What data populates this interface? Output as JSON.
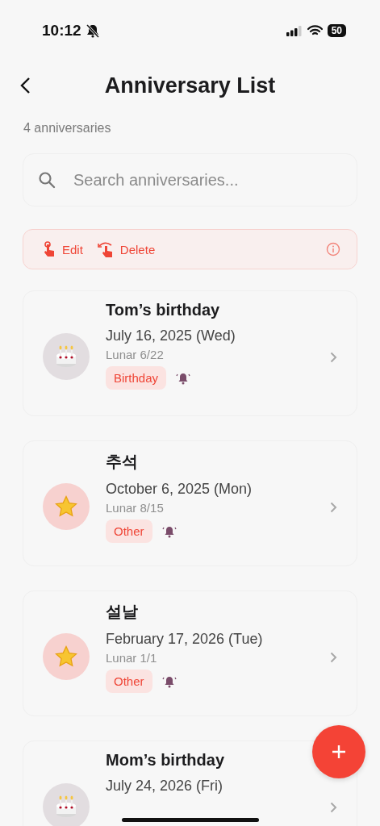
{
  "status_bar": {
    "time": "10:12",
    "silent": true,
    "battery": "50"
  },
  "header": {
    "title": "Anniversary List"
  },
  "count": "4 anniversaries",
  "search": {
    "placeholder": "Search anniversaries..."
  },
  "hint_bar": {
    "actions": [
      {
        "kind": "tap",
        "label": "Edit"
      },
      {
        "kind": "swipe",
        "label": "Delete"
      }
    ]
  },
  "anniversaries": [
    {
      "kind": "birthday",
      "title": "Tom’s birthday",
      "date": "July 16, 2025 (Wed)",
      "lunar": "Lunar 6/22",
      "tag": "Birthday",
      "alarm": true
    },
    {
      "kind": "other",
      "title": "추석",
      "date": "October 6, 2025 (Mon)",
      "lunar": "Lunar 8/15",
      "tag": "Other",
      "alarm": true
    },
    {
      "kind": "other",
      "title": "설날",
      "date": "February 17, 2026 (Tue)",
      "lunar": "Lunar 1/1",
      "tag": "Other",
      "alarm": true
    },
    {
      "kind": "birthday",
      "title": "Mom’s birthday",
      "date": "July 24, 2026 (Fri)"
    }
  ]
}
